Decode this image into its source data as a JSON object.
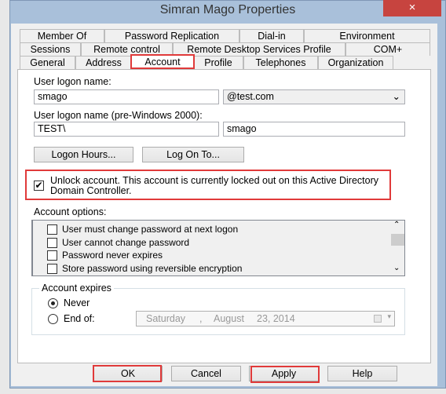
{
  "window": {
    "title": "Simran Mago Properties",
    "close_icon": "×"
  },
  "tabs": {
    "row1": [
      "Member Of",
      "Password Replication",
      "Dial-in",
      "Environment"
    ],
    "row2": [
      "Sessions",
      "Remote control",
      "Remote Desktop Services Profile",
      "COM+"
    ],
    "row3": [
      "General",
      "Address",
      "Account",
      "Profile",
      "Telephones",
      "Organization"
    ],
    "selected": "Account"
  },
  "account": {
    "logon_name_label": "User logon name:",
    "logon_name_value": "smago",
    "domain_value": "@test.com",
    "pre2000_label": "User logon name (pre-Windows 2000):",
    "pre2000_domain": "TEST\\",
    "pre2000_name": "smago",
    "logon_hours_button": "Logon Hours...",
    "log_on_to_button": "Log On To...",
    "unlock_checked": true,
    "unlock_text": "Unlock account. This account is currently locked out on this Active Directory Domain Controller.",
    "options_label": "Account options:",
    "options": [
      {
        "label": "User must change password at next logon",
        "checked": false
      },
      {
        "label": "User cannot change password",
        "checked": false
      },
      {
        "label": "Password never expires",
        "checked": false
      },
      {
        "label": "Store password using reversible encryption",
        "checked": false
      }
    ],
    "expires_label": "Account expires",
    "never_label": "Never",
    "end_of_label": "End of:",
    "expires_selected": "Never",
    "date": {
      "weekday": "Saturday",
      "sep": ",",
      "month": "August",
      "day_year": "23, 2014"
    }
  },
  "buttons": {
    "ok": "OK",
    "cancel": "Cancel",
    "apply": "Apply",
    "help": "Help"
  },
  "colors": {
    "highlight": "#e03a3a",
    "frame": "#a9c0da",
    "close": "#c7443f"
  }
}
